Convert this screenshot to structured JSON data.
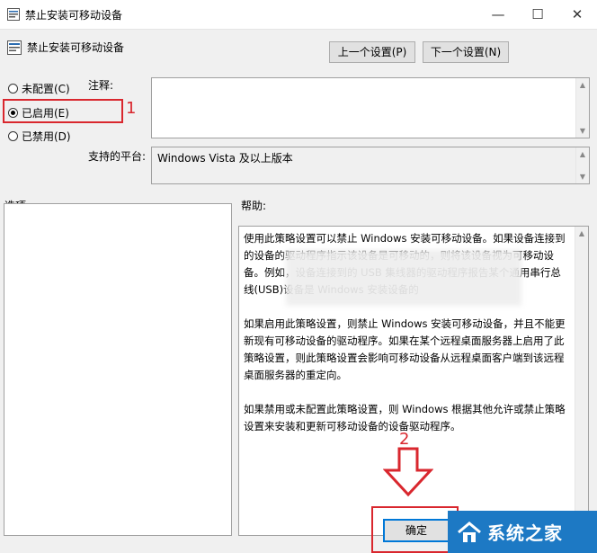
{
  "window": {
    "title": "禁止安装可移动设备",
    "minimize": "—",
    "maximize": "☐",
    "close": "✕"
  },
  "header": {
    "policy_name": "禁止安装可移动设备",
    "prev_button": "上一个设置(P)",
    "next_button": "下一个设置(N)"
  },
  "state_options": [
    {
      "label": "未配置(C)",
      "checked": false
    },
    {
      "label": "已启用(E)",
      "checked": true
    },
    {
      "label": "已禁用(D)",
      "checked": false
    }
  ],
  "comment": {
    "label": "注释:",
    "value": ""
  },
  "platform": {
    "label": "支持的平台:",
    "value": "Windows Vista 及以上版本"
  },
  "options": {
    "label": "选项:"
  },
  "help": {
    "label": "帮助:",
    "paragraphs": [
      "使用此策略设置可以禁止 Windows 安装可移动设备。如果设备连接到的设备的驱动程序指示该设备是可移动的，则将该设备视为可移动设备。例如，设备连接到的 USB 集线器的驱动程序报告某个通用串行总线(USB)设备是                                               Windows 安装设备的",
      "如果启用此策略设置，则禁止 Windows 安装可移动设备，并且不能更新现有可移动设备的驱动程序。如果在某个远程桌面服务器上启用了此策略设置，则此策略设置会影响可移动设备从远程桌面客户端到该远程桌面服务器的重定向。",
      "如果禁用或未配置此策略设置，则 Windows 根据其他允许或禁止策略设置来安装和更新可移动设备的设备驱动程序。"
    ]
  },
  "annotations": {
    "step1": "1",
    "step2": "2",
    "color": "#d9272e"
  },
  "footer": {
    "ok_button": "确定"
  },
  "watermark": {
    "text": "系统之家"
  }
}
